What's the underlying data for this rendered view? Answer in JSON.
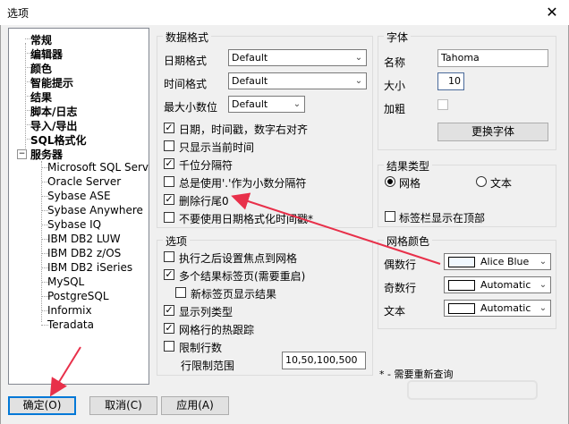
{
  "window": {
    "title": "选项",
    "close_glyph": "✕"
  },
  "tree": {
    "items": [
      "常规",
      "编辑器",
      "颜色",
      "智能提示",
      "结果",
      "脚本/日志",
      "导入/导出",
      "SQL格式化",
      "服务器"
    ],
    "servers": [
      "Microsoft SQL Server",
      "Oracle Server",
      "Sybase ASE",
      "Sybase Anywhere",
      "Sybase IQ",
      "IBM DB2 LUW",
      "IBM DB2 z/OS",
      "IBM DB2 iSeries",
      "MySQL",
      "PostgreSQL",
      "Informix",
      "Teradata"
    ],
    "minus_glyph": "−"
  },
  "data_format": {
    "title": "数据格式",
    "date_label": "日期格式",
    "date_value": "Default",
    "time_label": "时间格式",
    "time_value": "Default",
    "decimal_label": "最大小数位",
    "decimal_value": "Default",
    "checkboxes": [
      {
        "label": "日期，时间戳，数字右对齐",
        "checked": true
      },
      {
        "label": "只显示当前时间",
        "checked": false
      },
      {
        "label": "千位分隔符",
        "checked": true
      },
      {
        "label": "总是使用'.'作为小数分隔符",
        "checked": false
      },
      {
        "label": "删除行尾0",
        "checked": true
      },
      {
        "label": "不要使用日期格式化时间戳*",
        "checked": false
      }
    ]
  },
  "options": {
    "title": "选项",
    "checkboxes": [
      {
        "label": "执行之后设置焦点到网格",
        "checked": false
      },
      {
        "label": "多个结果标签页(需要重启)",
        "checked": true
      },
      {
        "label": "新标签页显示结果",
        "checked": false
      },
      {
        "label": "显示列类型",
        "checked": true
      },
      {
        "label": "网格行的热跟踪",
        "checked": true
      },
      {
        "label": "限制行数",
        "checked": false
      }
    ],
    "limit_label": "行限制范围",
    "limit_value": "10,50,100,500"
  },
  "font": {
    "title": "字体",
    "name_label": "名称",
    "name_value": "Tahoma",
    "size_label": "大小",
    "size_value": "10",
    "bold_label": "加粗",
    "change_button": "更换字体"
  },
  "result_type": {
    "title": "结果类型",
    "grid_label": "网格",
    "text_label": "文本",
    "tab_top_label": "标签栏显示在顶部",
    "selected": "网格"
  },
  "grid_color": {
    "title": "网格颜色",
    "rows": [
      {
        "label": "偶数行",
        "value": "Alice Blue",
        "color": "#f0f8ff"
      },
      {
        "label": "奇数行",
        "value": "Automatic",
        "color": "#ffffff"
      },
      {
        "label": "文本",
        "value": "Automatic",
        "color": "#ffffff"
      }
    ]
  },
  "note": "* - 需要重新查询",
  "buttons": {
    "ok": "确定(O)",
    "cancel": "取消(C)",
    "apply": "应用(A)"
  },
  "dropdown_glyph": "⌄",
  "check_glyph": "✓",
  "accent_color": "#0078d7",
  "arrow_color": "#e8304a"
}
